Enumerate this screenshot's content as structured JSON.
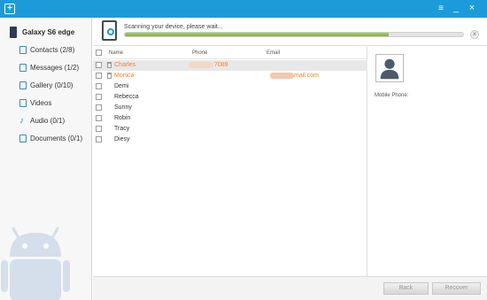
{
  "window": {
    "app_icon": "plus-icon",
    "menu_icon": "menu-icon",
    "minimize_icon": "minimize-icon",
    "close_icon": "close-icon"
  },
  "sidebar": {
    "device_name": "Galaxy S6 edge",
    "items": [
      {
        "label": "Contacts (2/8)",
        "icon": "contacts-icon"
      },
      {
        "label": "Messages (1/2)",
        "icon": "messages-icon"
      },
      {
        "label": "Gallery (0/10)",
        "icon": "gallery-icon"
      },
      {
        "label": "Videos",
        "icon": "videos-icon"
      },
      {
        "label": "Audio (0/1)",
        "icon": "audio-icon"
      },
      {
        "label": "Documents (0/1)",
        "icon": "documents-icon"
      }
    ]
  },
  "scan": {
    "status_text": "Scanning your device, please wait...",
    "progress_fraction": 0.78
  },
  "contacts": {
    "headers": {
      "name": "Name",
      "phone": "Phone",
      "email": "Email"
    },
    "rows": [
      {
        "name": "Charles",
        "phone": "7089",
        "email": "",
        "deleted": true,
        "highlight": true
      },
      {
        "name": "Monica",
        "phone": "",
        "email": "mail.com",
        "deleted": true,
        "highlight": false
      },
      {
        "name": "Demi",
        "phone": "",
        "email": "",
        "deleted": false,
        "highlight": false
      },
      {
        "name": "Rebecca",
        "phone": "",
        "email": "",
        "deleted": false,
        "highlight": false
      },
      {
        "name": "Sunny",
        "phone": "",
        "email": "",
        "deleted": false,
        "highlight": false
      },
      {
        "name": "Robin",
        "phone": "",
        "email": "",
        "deleted": false,
        "highlight": false
      },
      {
        "name": "Tracy",
        "phone": "",
        "email": "",
        "deleted": false,
        "highlight": false
      },
      {
        "name": "Diesy",
        "phone": "",
        "email": "",
        "deleted": false,
        "highlight": false
      }
    ]
  },
  "detail": {
    "mobile_phone_label": "Mobile Phone:"
  },
  "footer": {
    "back_label": "Back",
    "recover_label": "Recover"
  },
  "colors": {
    "accent": "#1d9bd9",
    "deleted_text": "#f07f2f",
    "progress": "#8cc63f"
  }
}
